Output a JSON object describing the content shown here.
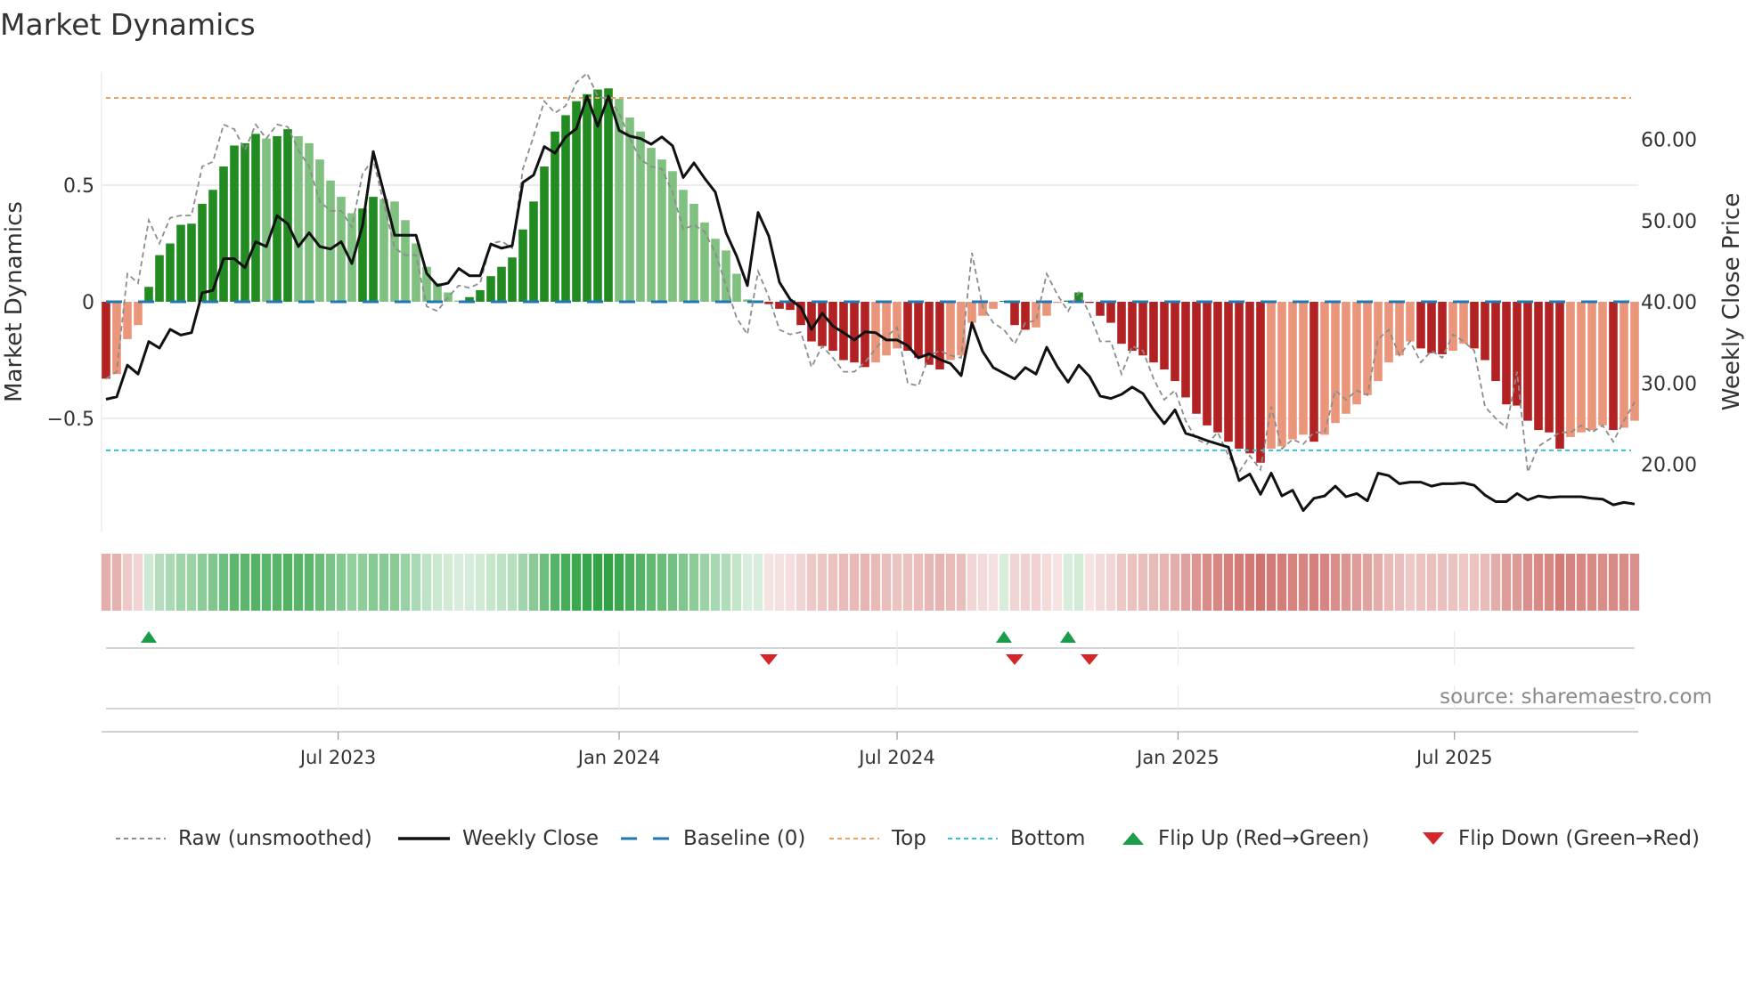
{
  "title": "Market Dynamics",
  "source": "source: sharemaestro.com",
  "chart_data": {
    "type": "bar",
    "title": "Market Dynamics",
    "ylabel": "Market Dynamics",
    "y2label": "Weekly Close Price",
    "ylim": [
      -0.79,
      0.99
    ],
    "y2lim": [
      10.7,
      68
    ],
    "x_start": "2023-01-30",
    "x_step_days": 7,
    "xticks": [
      {
        "date": "2023-07-01",
        "label": "Jul 2023"
      },
      {
        "date": "2024-01-01",
        "label": "Jan 2024"
      },
      {
        "date": "2024-07-01",
        "label": "Jul 2024"
      },
      {
        "date": "2025-01-01",
        "label": "Jan 2025"
      },
      {
        "date": "2025-07-01",
        "label": "Jul 2025"
      }
    ],
    "yticks": [
      {
        "v": 0.5,
        "label": "0.5"
      },
      {
        "v": 0,
        "label": "0"
      },
      {
        "v": -0.5,
        "label": "−0.5"
      }
    ],
    "y2ticks": [
      {
        "v": 60,
        "label": "60.00"
      },
      {
        "v": 50,
        "label": "50.00"
      },
      {
        "v": 40,
        "label": "40.00"
      },
      {
        "v": 30,
        "label": "30.00"
      },
      {
        "v": 20,
        "label": "20.00"
      }
    ],
    "top_level": 0.874,
    "bottom_level": -0.637,
    "baseline": 0,
    "colors": {
      "up_strong": "#228b22",
      "up_weak": "#80c080",
      "down_strong": "#b22222",
      "down_weak": "#e9967a",
      "close": "#111111",
      "raw": "#8c8c8c",
      "baseline": "#1f77b4",
      "top": "#f0a060",
      "bottom": "#2ec4d6",
      "flip_up": "#1a9c4a",
      "flip_down": "#d62728",
      "heat_up": "46,160,67",
      "heat_down": "205,110,105"
    },
    "smoothed": [
      -0.33,
      -0.31,
      -0.16,
      -0.1,
      0.064,
      0.2,
      0.25,
      0.33,
      0.335,
      0.42,
      0.48,
      0.58,
      0.67,
      0.68,
      0.72,
      0.7,
      0.71,
      0.74,
      0.71,
      0.68,
      0.61,
      0.52,
      0.45,
      0.38,
      0.4,
      0.45,
      0.44,
      0.43,
      0.35,
      0.25,
      0.15,
      0.08,
      0.04,
      0.005,
      0.02,
      0.05,
      0.11,
      0.15,
      0.19,
      0.31,
      0.43,
      0.58,
      0.73,
      0.8,
      0.86,
      0.89,
      0.91,
      0.915,
      0.87,
      0.79,
      0.73,
      0.66,
      0.61,
      0.56,
      0.48,
      0.42,
      0.34,
      0.27,
      0.22,
      0.12,
      0.01,
      0.003,
      -0.01,
      -0.03,
      -0.035,
      -0.1,
      -0.17,
      -0.19,
      -0.21,
      -0.25,
      -0.26,
      -0.28,
      -0.26,
      -0.23,
      -0.2,
      -0.21,
      -0.24,
      -0.27,
      -0.29,
      -0.25,
      -0.23,
      -0.09,
      -0.06,
      -0.03,
      0.004,
      -0.1,
      -0.12,
      -0.11,
      -0.06,
      -0.005,
      0.005,
      0.04,
      -0.005,
      -0.06,
      -0.09,
      -0.18,
      -0.21,
      -0.23,
      -0.26,
      -0.29,
      -0.34,
      -0.41,
      -0.48,
      -0.53,
      -0.56,
      -0.6,
      -0.63,
      -0.65,
      -0.69,
      -0.63,
      -0.62,
      -0.59,
      -0.57,
      -0.6,
      -0.57,
      -0.52,
      -0.48,
      -0.44,
      -0.4,
      -0.34,
      -0.26,
      -0.23,
      -0.17,
      -0.2,
      -0.22,
      -0.225,
      -0.21,
      -0.18,
      -0.2,
      -0.25,
      -0.34,
      -0.44,
      -0.445,
      -0.51,
      -0.55,
      -0.56,
      -0.63,
      -0.58,
      -0.56,
      -0.55,
      -0.53,
      -0.55,
      -0.54,
      -0.51
    ],
    "raw": [
      -0.33,
      -0.3,
      0.12,
      0.08,
      0.35,
      0.25,
      0.36,
      0.37,
      0.37,
      0.58,
      0.6,
      0.76,
      0.74,
      0.65,
      0.76,
      0.7,
      0.76,
      0.75,
      0.65,
      0.58,
      0.43,
      0.39,
      0.39,
      0.32,
      0.55,
      0.61,
      0.42,
      0.23,
      0.2,
      0.2,
      -0.02,
      -0.04,
      0.02,
      0.07,
      0.06,
      0.08,
      0.25,
      0.26,
      0.23,
      0.57,
      0.71,
      0.86,
      0.81,
      0.84,
      0.94,
      0.98,
      0.88,
      0.87,
      0.81,
      0.7,
      0.61,
      0.58,
      0.57,
      0.47,
      0.31,
      0.33,
      0.3,
      0.21,
      0.07,
      -0.07,
      -0.14,
      0.13,
      0.02,
      -0.12,
      -0.14,
      -0.13,
      -0.28,
      -0.19,
      -0.24,
      -0.3,
      -0.3,
      -0.26,
      -0.2,
      -0.15,
      -0.11,
      -0.35,
      -0.36,
      -0.23,
      -0.21,
      -0.23,
      -0.24,
      0.21,
      -0.02,
      -0.09,
      -0.12,
      -0.18,
      -0.09,
      -0.08,
      0.12,
      0.03,
      -0.04,
      0.04,
      -0.05,
      -0.17,
      -0.17,
      -0.31,
      -0.19,
      -0.21,
      -0.33,
      -0.42,
      -0.38,
      -0.51,
      -0.59,
      -0.61,
      -0.56,
      -0.66,
      -0.73,
      -0.66,
      -0.72,
      -0.45,
      -0.63,
      -0.59,
      -0.61,
      -0.56,
      -0.56,
      -0.38,
      -0.42,
      -0.38,
      -0.4,
      -0.16,
      -0.12,
      -0.23,
      -0.17,
      -0.26,
      -0.21,
      -0.24,
      -0.14,
      -0.17,
      -0.21,
      -0.45,
      -0.5,
      -0.54,
      -0.3,
      -0.73,
      -0.62,
      -0.59,
      -0.56,
      -0.56,
      -0.53,
      -0.56,
      -0.53,
      -0.6,
      -0.51,
      -0.43
    ],
    "close": [
      28.0,
      28.3,
      32.2,
      31.1,
      35.1,
      34.3,
      36.6,
      35.9,
      36.2,
      41.1,
      41.4,
      45.3,
      45.3,
      44.2,
      47.4,
      46.8,
      50.6,
      49.6,
      46.8,
      48.5,
      46.8,
      46.5,
      47.4,
      44.7,
      49.4,
      58.5,
      53.4,
      48.2,
      48.2,
      48.2,
      43.5,
      42.0,
      42.3,
      44.1,
      43.2,
      43.2,
      47.1,
      46.6,
      46.9,
      54.7,
      55.6,
      59.1,
      58.3,
      60.3,
      61.3,
      65.3,
      61.6,
      65.3,
      61.1,
      60.4,
      60.1,
      59.4,
      60.3,
      59.2,
      55.3,
      57.1,
      55.2,
      53.5,
      48.5,
      45.6,
      42.0,
      51.0,
      48.1,
      42.4,
      40.3,
      39.3,
      36.6,
      38.6,
      37.0,
      36.2,
      35.3,
      36.3,
      36.2,
      35.3,
      35.3,
      34.6,
      33.1,
      33.6,
      32.9,
      32.4,
      30.9,
      37.4,
      33.9,
      31.9,
      31.2,
      30.5,
      31.9,
      31.1,
      34.4,
      32.0,
      30.1,
      32.2,
      30.8,
      28.4,
      28.1,
      28.6,
      29.5,
      28.7,
      26.7,
      25.0,
      26.7,
      23.8,
      23.4,
      22.9,
      22.5,
      22.1,
      18.0,
      18.8,
      16.3,
      18.9,
      16.1,
      16.8,
      14.3,
      15.8,
      16.1,
      17.3,
      16.0,
      16.4,
      15.5,
      18.9,
      18.6,
      17.6,
      17.8,
      17.8,
      17.3,
      17.6,
      17.6,
      17.7,
      17.4,
      16.2,
      15.4,
      15.4,
      16.4,
      15.6,
      16.1,
      15.9,
      16.0,
      16.0,
      16.0,
      15.8,
      15.7,
      15.0,
      15.3,
      15.1
    ],
    "flips_up": [
      "2023-02-27",
      "2024-09-09",
      "2024-10-21"
    ],
    "flips_down": [
      "2024-04-08",
      "2024-09-16",
      "2024-11-04"
    ],
    "legend": [
      {
        "label": "Raw (unsmoothed)",
        "style": "raw"
      },
      {
        "label": "Weekly Close",
        "style": "close"
      },
      {
        "label": "Baseline (0)",
        "style": "baseline"
      },
      {
        "label": "Top",
        "style": "top"
      },
      {
        "label": "Bottom",
        "style": "bottom"
      },
      {
        "label": "Flip Up (Red→Green)",
        "style": "flip_up"
      },
      {
        "label": "Flip Down (Green→Red)",
        "style": "flip_down"
      }
    ]
  }
}
